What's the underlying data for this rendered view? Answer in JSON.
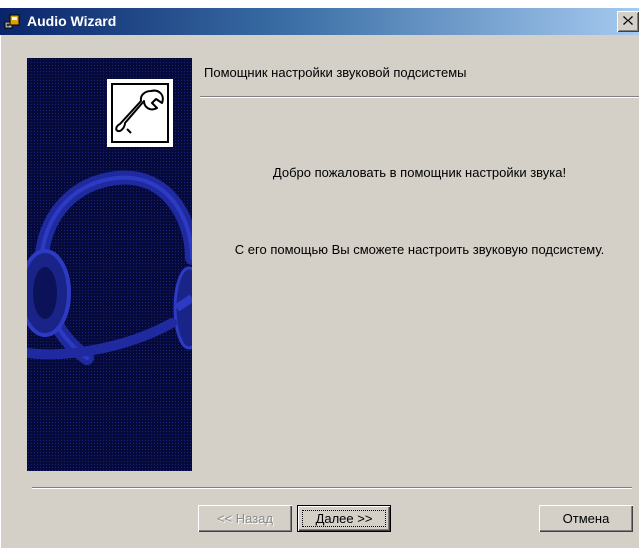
{
  "window": {
    "title": "Audio Wizard",
    "colors": {
      "titlebar_start": "#0a246a",
      "titlebar_end": "#a6caf0",
      "face": "#d4d0c8",
      "banner": "#050a3a",
      "headset": "#1f2aa0"
    }
  },
  "header": {
    "text": "Помощник настройки звуковой подсистемы"
  },
  "content": {
    "welcome": "Добро пожаловать в помощник настройки звука!",
    "description": "С его помощью Вы сможете настроить звуковую подсистему."
  },
  "buttons": {
    "back": "<< Назад",
    "next": "Далее >>",
    "cancel": "Отмена"
  },
  "icons": {
    "app": "audio-wizard-icon",
    "close": "close-icon",
    "wrench": "wrench-icon",
    "headset": "headset-illustration"
  }
}
